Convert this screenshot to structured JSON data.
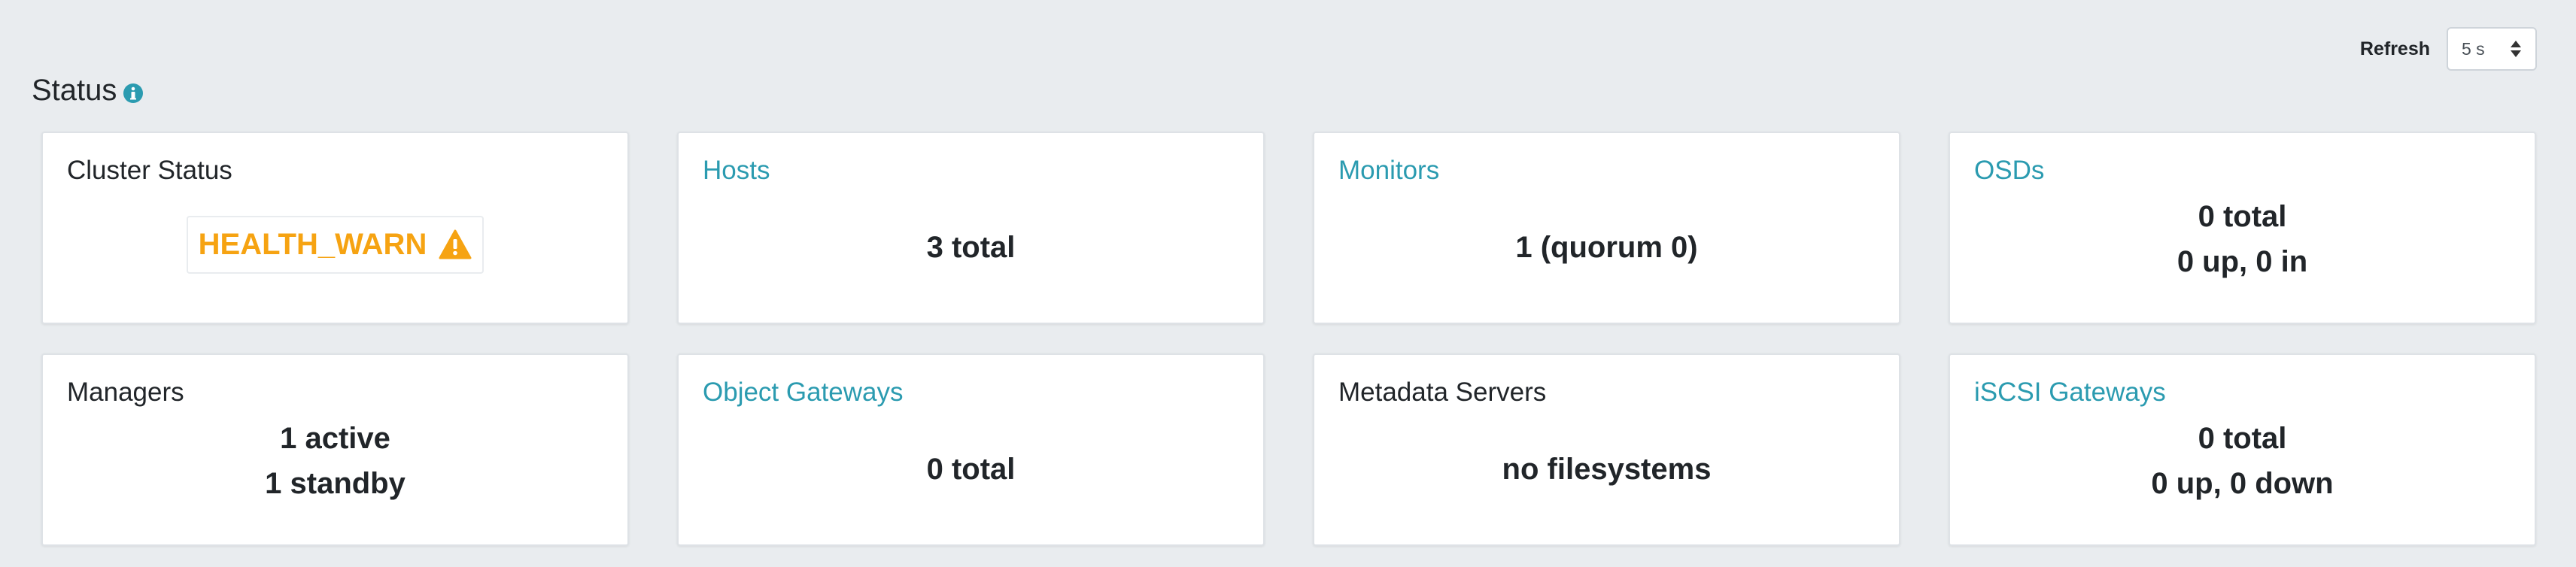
{
  "header": {
    "refresh_label": "Refresh",
    "refresh_value": "5 s",
    "status_title": "Status"
  },
  "colors": {
    "background": "#e9ecef",
    "link": "#2b9bb0",
    "warning": "#f6a312",
    "info_icon": "#2b9bb0"
  },
  "cards": {
    "cluster_status": {
      "title": "Cluster Status",
      "health": "HEALTH_WARN",
      "icon": "warning-icon"
    },
    "hosts": {
      "title": "Hosts",
      "line1": "3 total"
    },
    "monitors": {
      "title": "Monitors",
      "line1": "1 (quorum 0)"
    },
    "osds": {
      "title": "OSDs",
      "line1": "0 total",
      "line2": "0 up, 0 in"
    },
    "managers": {
      "title": "Managers",
      "line1": "1 active",
      "line2": "1 standby"
    },
    "object_gateways": {
      "title": "Object Gateways",
      "line1": "0 total"
    },
    "metadata_servers": {
      "title": "Metadata Servers",
      "line1": "no filesystems"
    },
    "iscsi_gateways": {
      "title": "iSCSI Gateways",
      "line1": "0 total",
      "line2": "0 up, 0 down"
    }
  }
}
